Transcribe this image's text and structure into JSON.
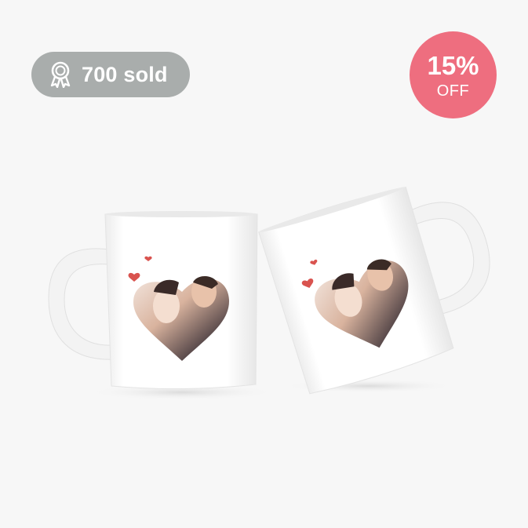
{
  "badges": {
    "sold": {
      "label": "700 sold",
      "icon": "award-ribbon-icon"
    },
    "discount": {
      "percent": "15%",
      "label": "OFF"
    }
  },
  "colors": {
    "background": "#f7f7f7",
    "sold_badge": "#a9adac",
    "discount_badge": "#ee6e7f"
  },
  "product_image": {
    "subject": "two white mugs with heart-shaped couple photo print",
    "mug_count": 2
  }
}
